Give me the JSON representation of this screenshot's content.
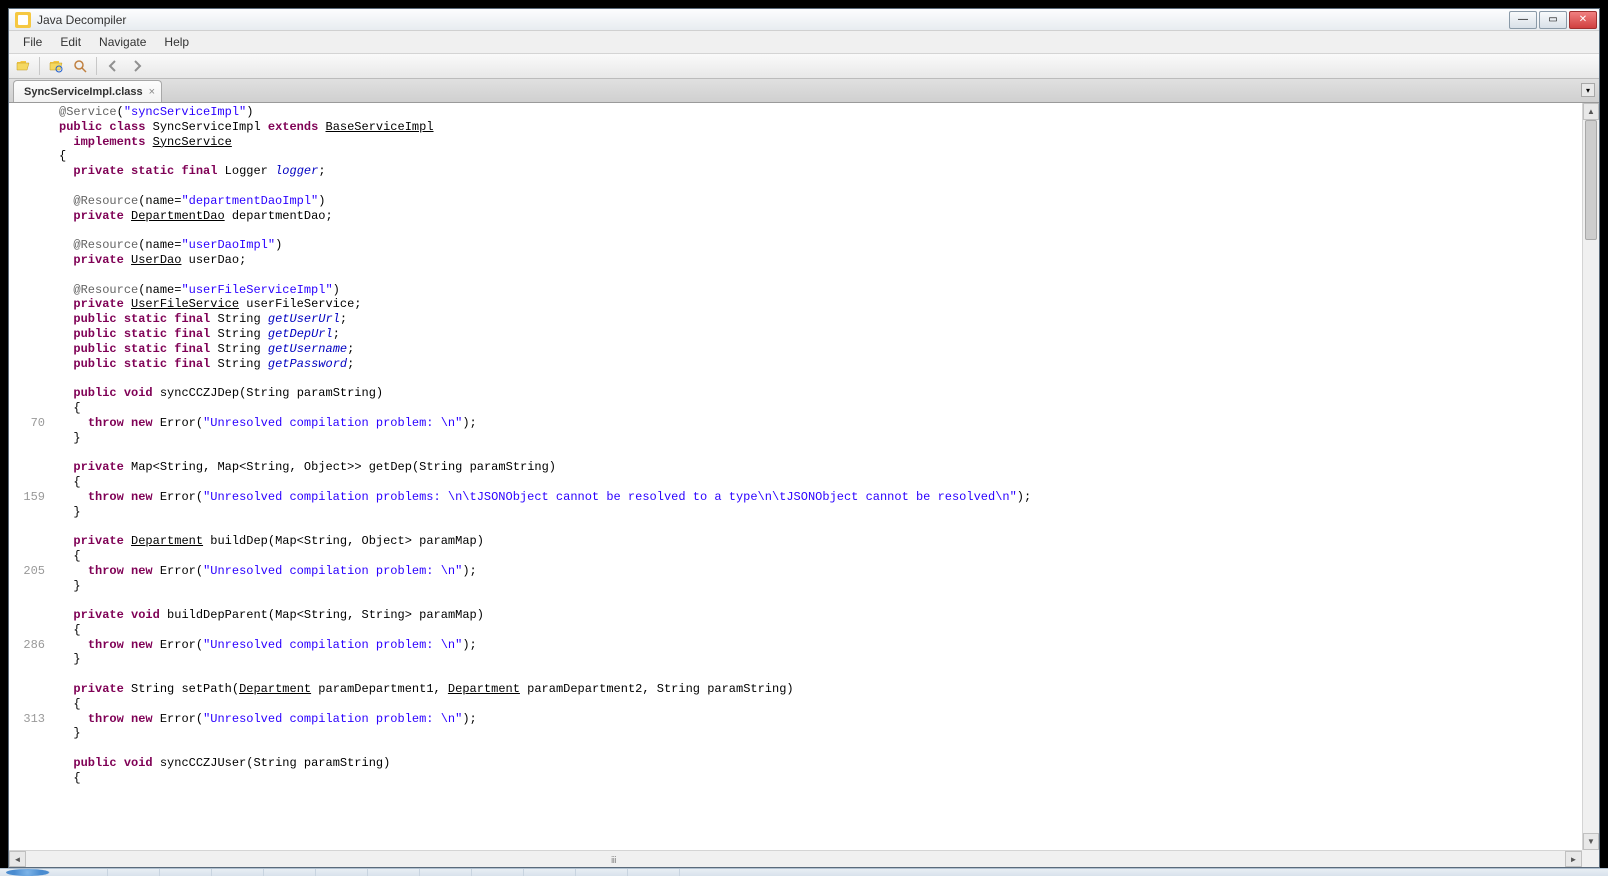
{
  "window": {
    "title": "Java Decompiler"
  },
  "menu": {
    "file": "File",
    "edit": "Edit",
    "navigate": "Navigate",
    "help": "Help"
  },
  "tab": {
    "name": "SyncServiceImpl.class",
    "close": "×"
  },
  "gutter": {
    "l70": "70",
    "l159": "159",
    "l205": "205",
    "l286": "286",
    "l313": "313"
  },
  "code": {
    "tok": {
      "atService": "@Service",
      "atResource": "@Resource",
      "name": "name",
      "public": "public",
      "private": "private",
      "class": "class",
      "extends": "extends",
      "implements": "implements",
      "static": "static",
      "final": "final",
      "void": "void",
      "throw": "throw",
      "new": "new"
    },
    "id": {
      "SyncServiceImpl": "SyncServiceImpl",
      "BaseServiceImpl": "BaseServiceImpl",
      "SyncService": "SyncService",
      "Logger": "Logger",
      "logger": "logger",
      "DepartmentDao": "DepartmentDao",
      "departmentDao": "departmentDao",
      "UserDao": "UserDao",
      "userDao": "userDao",
      "UserFileService": "UserFileService",
      "userFileService": "userFileService",
      "String": "String",
      "getUserUrl": "getUserUrl",
      "getDepUrl": "getDepUrl",
      "getUsername": "getUsername",
      "getPassword": "getPassword",
      "syncCCZJDep": "syncCCZJDep",
      "paramString": "paramString",
      "Error": "Error",
      "Map": "Map",
      "Object": "Object",
      "getDep": "getDep",
      "Department": "Department",
      "buildDep": "buildDep",
      "paramMap": "paramMap",
      "buildDepParent": "buildDepParent",
      "setPath": "setPath",
      "paramDepartment1": "paramDepartment1",
      "paramDepartment2": "paramDepartment2",
      "syncCCZJUser": "syncCCZJUser"
    },
    "str": {
      "syncServiceImpl": "\"syncServiceImpl\"",
      "departmentDaoImpl": "\"departmentDaoImpl\"",
      "userDaoImpl": "\"userDaoImpl\"",
      "userFileServiceImpl": "\"userFileServiceImpl\"",
      "err1": "\"Unresolved compilation problem: \\n\"",
      "err2": "\"Unresolved compilation problems: \\n\\tJSONObject cannot be resolved to a type\\n\\tJSONObject cannot be resolved\\n\""
    }
  },
  "scroll": {
    "up": "▲",
    "down": "▼",
    "left": "◄",
    "right": "►",
    "hmark": "ⅲ"
  }
}
